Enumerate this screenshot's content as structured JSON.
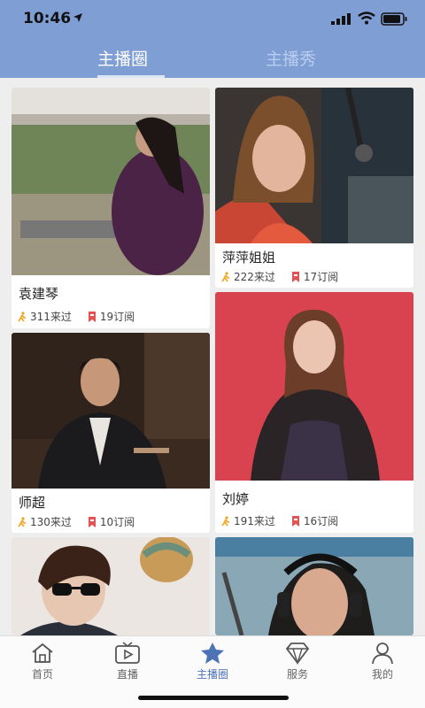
{
  "status": {
    "time": "10:46"
  },
  "tabs": [
    {
      "label": "主播圈",
      "active": true
    },
    {
      "label": "主播秀",
      "active": false
    }
  ],
  "anchors": [
    {
      "name": "袁建琴",
      "visits": "311来过",
      "subs": "19订阅",
      "photo_colors": [
        "#e6e3df",
        "#7c8a62"
      ]
    },
    {
      "name": "萍萍姐姐",
      "visits": "222来过",
      "subs": "17订阅",
      "photo_colors": [
        "#2f2b2a",
        "#8a6a4e"
      ]
    },
    {
      "name": "师超",
      "visits": "130来过",
      "subs": "10订阅",
      "photo_colors": [
        "#3a2b22",
        "#b59876"
      ]
    },
    {
      "name": "刘婷",
      "visits": "191来过",
      "subs": "16订阅",
      "photo_colors": [
        "#d44557",
        "#c93a4b"
      ]
    },
    {
      "name": "",
      "photo_colors": [
        "#e9e4de",
        "#c7a36b"
      ]
    },
    {
      "name": "",
      "photo_colors": [
        "#86a6b7",
        "#3d4b52"
      ]
    }
  ],
  "tabbar": [
    {
      "label": "首页",
      "icon": "home-icon"
    },
    {
      "label": "直播",
      "icon": "tv-icon"
    },
    {
      "label": "主播圈",
      "icon": "star-icon",
      "active": true
    },
    {
      "label": "服务",
      "icon": "service-icon"
    },
    {
      "label": "我的",
      "icon": "user-icon"
    }
  ],
  "colors": {
    "header": "#7f9ed3",
    "accent": "#4d73b7",
    "run": "#f3a21b",
    "bookmark": "#e25454"
  }
}
